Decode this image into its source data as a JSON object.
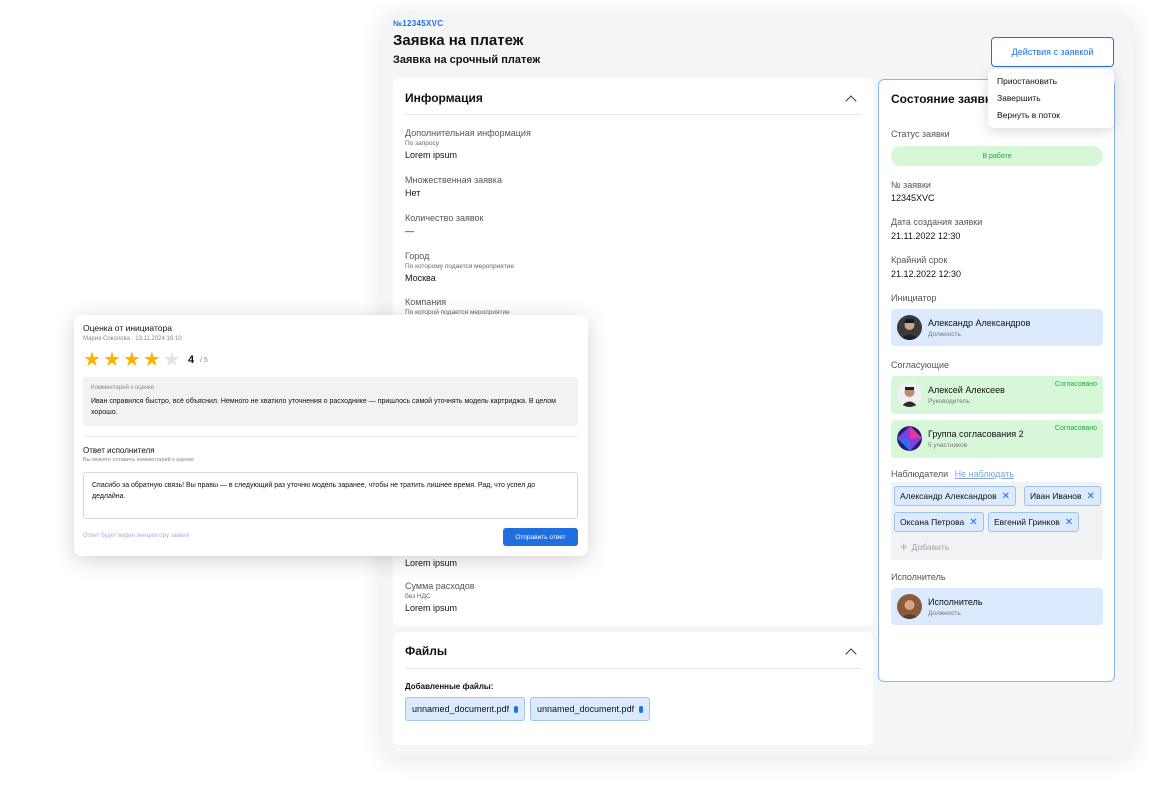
{
  "request": {
    "id": "№12345XVC",
    "title": "Заявка на платеж",
    "subtitle": "Заявка на срочный платеж",
    "actions_label": "Действия с заявкой",
    "actions_menu": [
      "Приостановить",
      "Завершить",
      "Вернуть в поток"
    ]
  },
  "info": {
    "heading": "Информация",
    "fields": [
      {
        "label": "Дополнительная информация",
        "hint": "По запросу",
        "value": "Lorem ipsum"
      },
      {
        "label": "Множественная заявка",
        "hint": "",
        "value": "Нет"
      },
      {
        "label": "Количество заявок",
        "hint": "",
        "value": "—"
      },
      {
        "label": "Город",
        "hint": "По которому подается мероприятие",
        "value": "Москва"
      },
      {
        "label": "Компания",
        "hint": "По которой подается мероприятие",
        "value": ""
      }
    ],
    "lower_value": "Lorem ipsum",
    "expense": {
      "label": "Сумма расходов",
      "hint": "без НДС",
      "value": "Lorem ipsum"
    }
  },
  "files": {
    "heading": "Файлы",
    "added_label": "Добавленные файлы:",
    "items": [
      "unnamed_document.pdf",
      "unnamed_document.pdf"
    ]
  },
  "status_panel": {
    "title": "Состояние заявки",
    "status_label": "Статус заявки",
    "status_value": "В работе",
    "number_label": "№ заявки",
    "number_value": "12345XVC",
    "created_label": "Дата создания заявки",
    "created_value": "21.11.2022  12:30",
    "deadline_label": "Крайний срок",
    "deadline_value": "21.12.2022  12:30",
    "initiator_label": "Инициатор",
    "initiator": {
      "name": "Александр Александров",
      "role": "Должность"
    },
    "approvers_label": "Согласующие",
    "approvers": [
      {
        "name": "Алексей Алексеев",
        "role": "Руководитель",
        "status": "Согласовано"
      },
      {
        "name": "Группа согласования 2",
        "role": "5 участников",
        "status": "Согласовано"
      }
    ],
    "observers_label": "Наблюдатели",
    "observers_link": "Не наблюдать",
    "observers": [
      "Александр Александров",
      "Иван Иванов",
      "Оксана Петрова",
      "Евгений Гринков"
    ],
    "add_label": "Добавить",
    "executor_label": "Исполнитель",
    "executor": {
      "name": "Исполнитель",
      "role": "Должность"
    }
  },
  "rating": {
    "title": "Оценка от инициатора",
    "meta": "Мария Соколова · 13.11.2024 16:10",
    "score": "4",
    "score_max": "/ 5",
    "stars_filled": 4,
    "stars_total": 5,
    "comment_label": "Комментарий к оценке",
    "comment_text": "Иван справился быстро, всё объяснил. Немного не хватило уточнения о расходнике — пришлось самой уточнять модель картриджа. В целом хорошо.",
    "answer_title": "Ответ исполнителя",
    "answer_hint": "Вы можете оставить комментарий к оценке",
    "answer_text": "Спасибо за обратную связь! Вы правы — в следующий раз уточню модель заранее, чтобы не тратить лишнее время. Рад, что успел до дедлайна.",
    "footer_note": "Ответ будет виден инициатору заявки",
    "send_label": "Отправить ответ"
  },
  "colors": {
    "accent": "#1f6fe0",
    "success": "#1bab36",
    "success_bg": "#d7f8d8",
    "chip_bg": "#dbeafe",
    "star": "#f7b500"
  }
}
